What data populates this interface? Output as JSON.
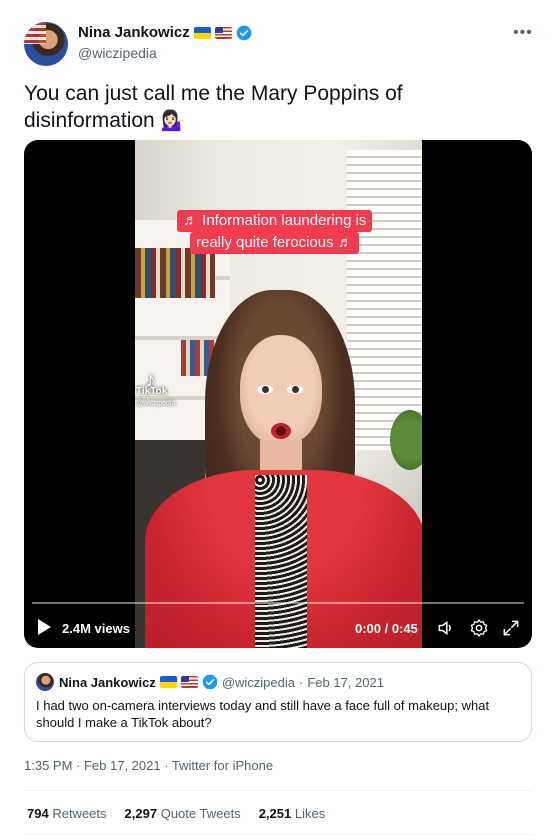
{
  "author": {
    "name": "Nina Jankowicz",
    "handle": "@wiczipedia",
    "more_icon": "more-horizontal-icon"
  },
  "tweet": {
    "text": "You can just call me the Mary Poppins of disinformation",
    "emoji": "💁🏻‍♀️"
  },
  "video": {
    "caption_line1": "♬ Information laundering is",
    "caption_line2": "really quite ferocious ♬",
    "watermark": "TikTok",
    "watermark_handle": "@wiczipedia",
    "views": "2.4M views",
    "time": "0:00 / 0:45",
    "progress": 0,
    "icons": [
      "play-icon",
      "volume-icon",
      "settings-icon",
      "fullscreen-icon"
    ]
  },
  "quoted": {
    "name": "Nina Jankowicz",
    "handle": "@wiczipedia",
    "separator": "·",
    "date": "Feb 17, 2021",
    "text": "I had two on-camera interviews today and still have a face full of makeup; what should I make a TikTok about?"
  },
  "timestamp": "1:35 PM · Feb 17, 2021 · Twitter for iPhone",
  "stats": {
    "retweets_count": "794",
    "retweets_label": "Retweets",
    "quotes_count": "2,297",
    "quotes_label": "Quote Tweets",
    "likes_count": "2,251",
    "likes_label": "Likes"
  },
  "colors": {
    "verified": "#1d9bf0",
    "caption_bg": "#f13b4f",
    "secondary_text": "#536471"
  }
}
